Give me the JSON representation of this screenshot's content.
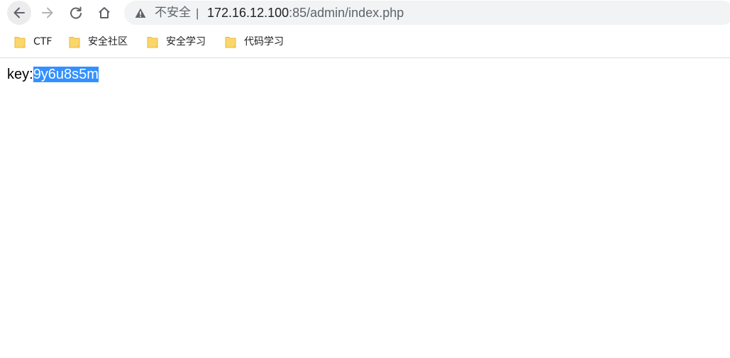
{
  "browser": {
    "security_label": "不安全",
    "separator": "|",
    "url_host": "172.16.12.100",
    "url_rest": ":85/admin/index.php",
    "buttons": {
      "back": "back-arrow-icon",
      "forward": "forward-arrow-icon",
      "reload": "reload-icon",
      "home": "home-icon"
    }
  },
  "bookmarks": [
    {
      "label": "CTF",
      "icon": "folder-icon"
    },
    {
      "label": "安全社区",
      "icon": "folder-icon"
    },
    {
      "label": "安全学习",
      "icon": "folder-icon"
    },
    {
      "label": "代码学习",
      "icon": "folder-icon"
    }
  ],
  "page": {
    "key_label": "key:",
    "key_value": "9y6u8s5m"
  },
  "colors": {
    "selection": "#3390ff",
    "folder": "#fbd66b"
  }
}
